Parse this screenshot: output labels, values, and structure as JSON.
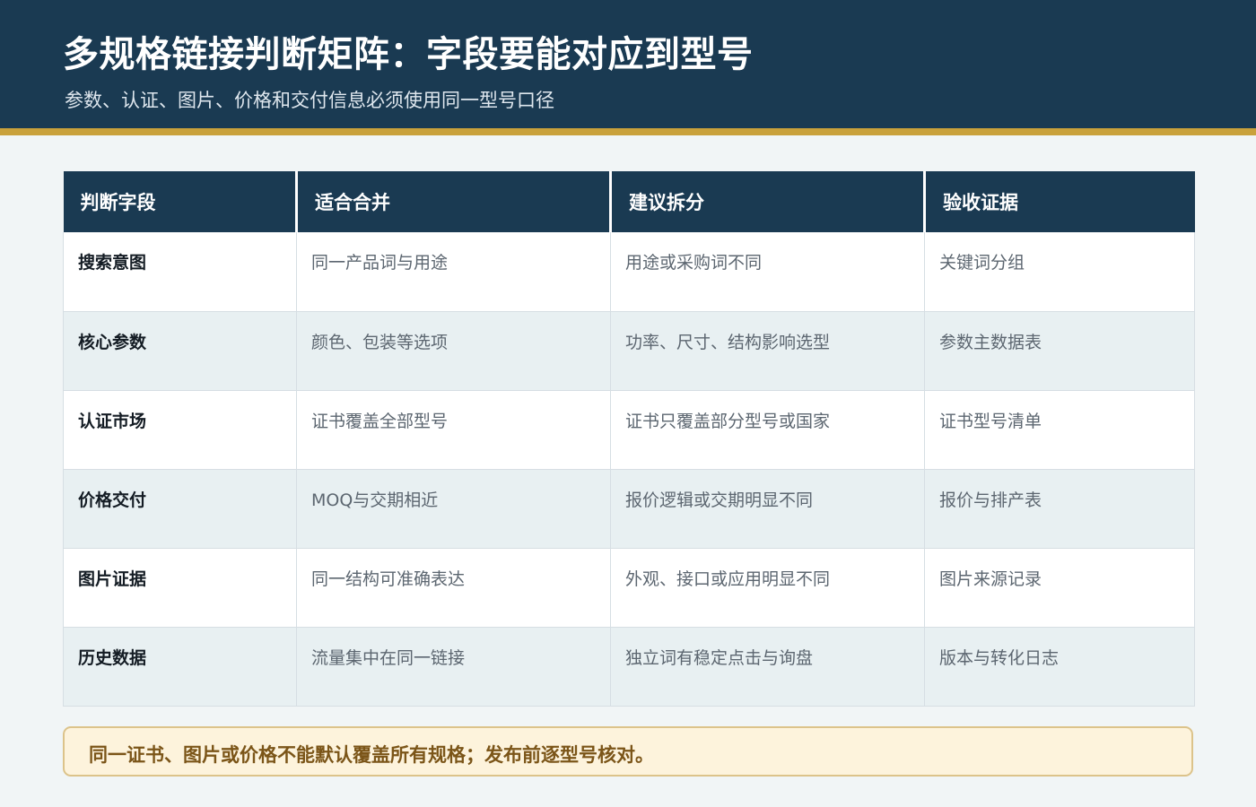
{
  "header": {
    "title": "多规格链接判断矩阵：字段要能对应到型号",
    "subtitle": "参数、认证、图片、价格和交付信息必须使用同一型号口径"
  },
  "table": {
    "headers": [
      "判断字段",
      "适合合并",
      "建议拆分",
      "验收证据"
    ],
    "rows": [
      [
        "搜索意图",
        "同一产品词与用途",
        "用途或采购词不同",
        "关键词分组"
      ],
      [
        "核心参数",
        "颜色、包装等选项",
        "功率、尺寸、结构影响选型",
        "参数主数据表"
      ],
      [
        "认证市场",
        "证书覆盖全部型号",
        "证书只覆盖部分型号或国家",
        "证书型号清单"
      ],
      [
        "价格交付",
        "MOQ与交期相近",
        "报价逻辑或交期明显不同",
        "报价与排产表"
      ],
      [
        "图片证据",
        "同一结构可准确表达",
        "外观、接口或应用明显不同",
        "图片来源记录"
      ],
      [
        "历史数据",
        "流量集中在同一链接",
        "独立词有稳定点击与询盘",
        "版本与转化日志"
      ]
    ]
  },
  "note": {
    "text": "同一证书、图片或价格不能默认覆盖所有规格；发布前逐型号核对。"
  },
  "colors": {
    "header_bg": "#1a3a52",
    "accent_gold": "#c9a13b",
    "row_alt_bg": "#e8f0f2",
    "note_bg": "#fdf3dc",
    "note_text": "#7b5518"
  }
}
